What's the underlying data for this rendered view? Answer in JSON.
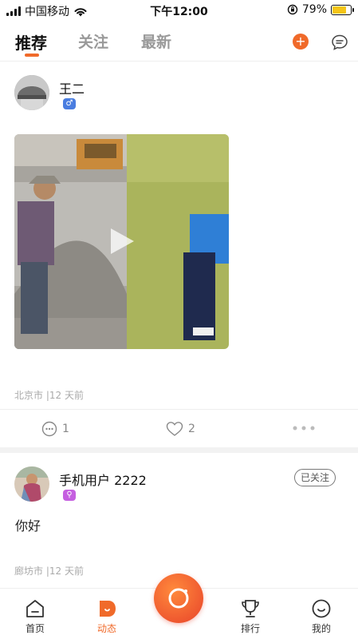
{
  "status_bar": {
    "carrier": "中国移动",
    "time": "下午12:00",
    "battery_percent": "79%",
    "battery_level": 0.79
  },
  "top_nav": {
    "tabs": [
      {
        "label": "推荐",
        "active": true
      },
      {
        "label": "关注",
        "active": false
      },
      {
        "label": "最新",
        "active": false
      }
    ],
    "add_icon": "plus-circle-icon",
    "message_icon": "chat-bubble-icon"
  },
  "posts": [
    {
      "username": "王二",
      "gender_badge": "♂",
      "gender_color": "#4a7de0",
      "location_time": "北京市 |12 天前",
      "comments": "1",
      "likes": "2"
    },
    {
      "username": "手机用户 2222",
      "gender_badge": "⚲",
      "gender_color": "#c55fe0",
      "follow_label": "已关注",
      "text": "你好",
      "location_time": "廊坊市 |12 天前"
    }
  ],
  "bottom_bar": {
    "items": [
      {
        "label": "首页",
        "icon": "home-icon",
        "active": false
      },
      {
        "label": "动态",
        "icon": "moments-icon",
        "active": true
      },
      {
        "label": "排行",
        "icon": "trophy-icon",
        "active": false
      },
      {
        "label": "我的",
        "icon": "profile-icon",
        "active": false
      }
    ],
    "center_icon": "camera-icon"
  },
  "colors": {
    "accent": "#f06a2a",
    "male_badge": "#4a7de0",
    "female_badge": "#c55fe0"
  }
}
